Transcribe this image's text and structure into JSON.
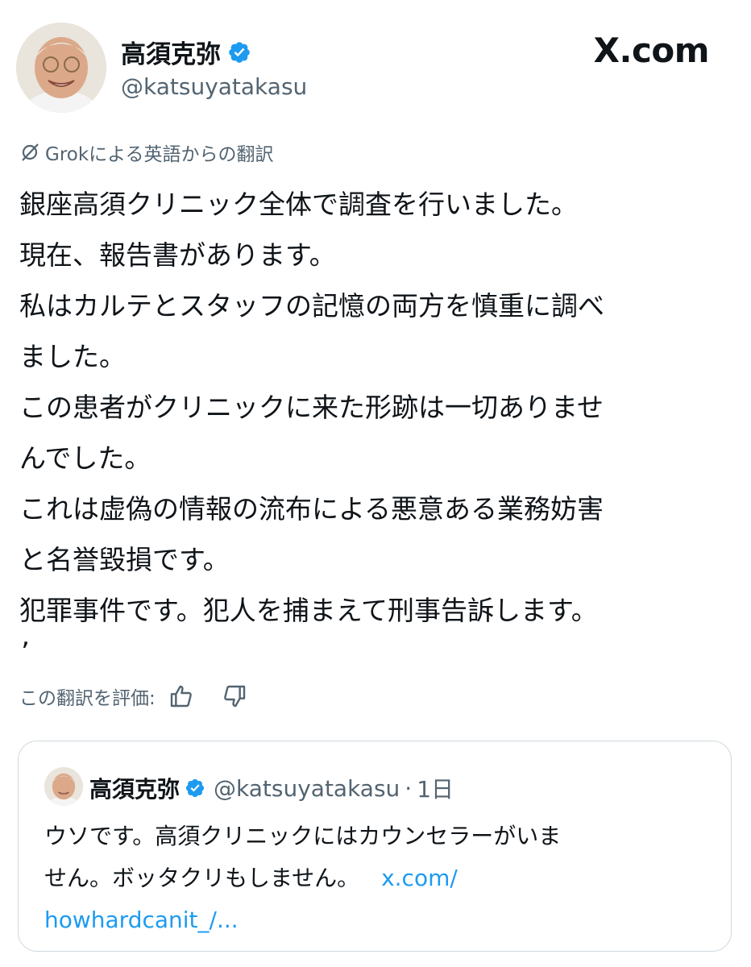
{
  "post": {
    "display_name": "高須克弥",
    "handle": "@katsuyatakasu",
    "brand": "X.com",
    "translation_label": "Grokによる英語からの翻訳",
    "body_lines": [
      "銀座高須クリニック全体で調査を行いました。",
      "現在、報告書があります。",
      "私はカルテとスタッフの記憶の両方を慎重に調べ",
      "ました。",
      "この患者がクリニックに来た形跡は一切ありませ",
      "んでした。",
      "これは虚偽の情報の流布による悪意ある業務妨害",
      "と名誉毀損です。",
      "犯罪事件です。犯人を捕まえて刑事告訴します。"
    ],
    "trailing_mark": "’",
    "rate_label": "この翻訳を評価:",
    "icons": {
      "verified": "verified-badge-icon",
      "grok": "grok-icon",
      "up": "thumbs-up-icon",
      "down": "thumbs-down-icon"
    },
    "colors": {
      "verified": "#1d9bf0",
      "link": "#1d9bf0",
      "muted": "#536471",
      "text": "#0f1419"
    }
  },
  "quote": {
    "display_name": "高須克弥",
    "handle": "@katsuyatakasu",
    "separator": "·",
    "time": "1日",
    "line1": "ウソです。高須クリニックにはカウンセラーがいま",
    "line2_text": "せん。ボッタクリもしません。",
    "link1": "x.com/",
    "link2": "howhardcanit_/..."
  }
}
